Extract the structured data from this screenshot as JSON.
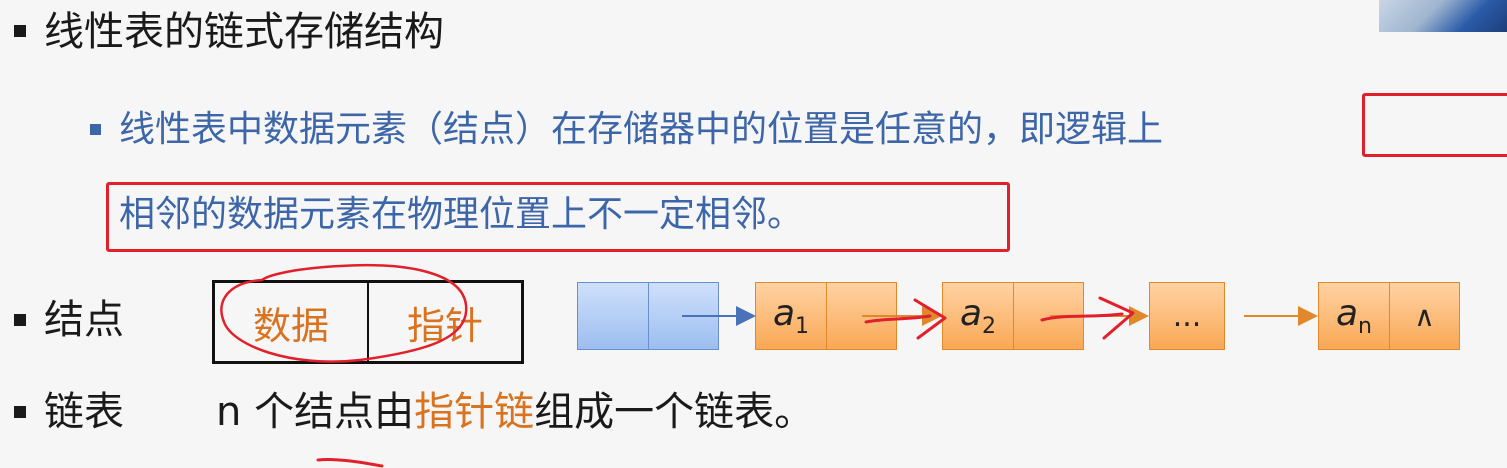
{
  "heading": "线性表的链式存储结构",
  "description": {
    "line1_part1": "线性表中数据元素（结点）在存储器中的位置是任意的，即",
    "line1_part2": "逻辑上",
    "line2": "相邻的数据元素在物理位置上不一定相邻。"
  },
  "node_row": {
    "label": "结点",
    "fields": [
      "数据",
      "指针"
    ]
  },
  "linked_list": {
    "nodes": [
      {
        "var": "a",
        "sub": "1"
      },
      {
        "var": "a",
        "sub": "2"
      },
      {
        "text": "..."
      },
      {
        "var": "a",
        "sub": "n",
        "terminator": "∧"
      }
    ]
  },
  "list_row": {
    "label": "链表",
    "text_pre": "n 个结点由",
    "text_highlight": "指针链",
    "text_post": "组成一个链表。"
  },
  "colors": {
    "text": "#1a1a1a",
    "blue_text": "#3d66a8",
    "orange": "#d9731f",
    "annotation_red": "#e2202c",
    "node_orange": "#f9a855",
    "node_blue": "#9cbef0"
  }
}
